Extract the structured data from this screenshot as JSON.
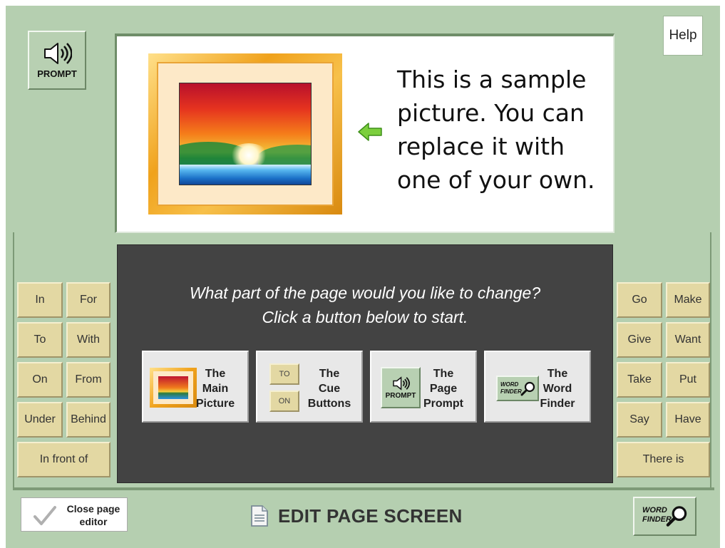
{
  "prompt_button": {
    "label": "PROMPT",
    "icon": "speaker-icon"
  },
  "help_button": {
    "label": "Help"
  },
  "picture_panel": {
    "sample_text": "This is a sample picture. You can replace it with one of your own."
  },
  "cue_left": [
    "In",
    "For",
    "To",
    "With",
    "On",
    "From",
    "Under",
    "Behind",
    "In front of"
  ],
  "cue_right": [
    "Go",
    "Make",
    "Give",
    "Want",
    "Take",
    "Put",
    "Say",
    "Have",
    "There is"
  ],
  "edit_panel": {
    "question_line1": "What part of the page would you like to change?",
    "question_line2": "Click a button below to start.",
    "options": [
      {
        "line1": "The",
        "line2": "Main",
        "line3": "Picture"
      },
      {
        "line1": "The",
        "line2": "Cue",
        "line3": "Buttons",
        "mini_top": "TO",
        "mini_bottom": "ON"
      },
      {
        "line1": "The",
        "line2": "Page",
        "line3": "Prompt",
        "mini_label": "PROMPT"
      },
      {
        "line1": "The",
        "line2": "Word",
        "line3": "Finder",
        "mini_label_1": "WORD",
        "mini_label_2": "FINDER"
      }
    ]
  },
  "footer": {
    "close_line1": "Close page",
    "close_line2": "editor",
    "title": "EDIT PAGE SCREEN",
    "finder_line1": "WORD",
    "finder_line2": "FINDER"
  },
  "colors": {
    "background_green": "#b5cfb0",
    "dark_panel": "#434343",
    "cue_button": "#e3d8a3",
    "frame_gold": "#f0a21c"
  }
}
